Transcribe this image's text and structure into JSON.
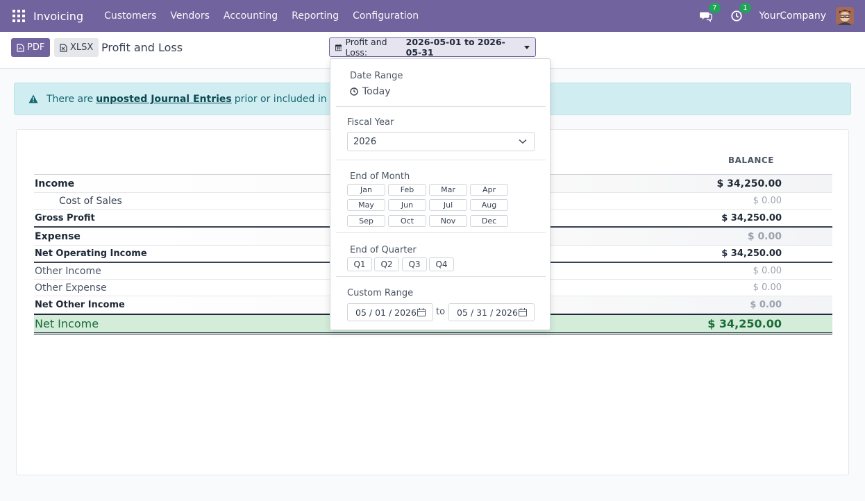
{
  "navbar": {
    "app_name": "Invoicing",
    "menu": [
      "Customers",
      "Vendors",
      "Accounting",
      "Reporting",
      "Configuration"
    ],
    "messages_count": "7",
    "activities_count": "1",
    "company": "YourCompany"
  },
  "control": {
    "pdf_label": "PDF",
    "xlsx_label": "XLSX",
    "title": "Profit and Loss",
    "filter_prefix": "Profit and Loss:",
    "filter_range": "2026-05-01 to 2026-05-31"
  },
  "alert": {
    "text_before": "There are",
    "link": "unposted Journal Entries",
    "text_after": "prior or included in this pe"
  },
  "report": {
    "column_header": "BALANCE",
    "rows": [
      {
        "label": "Income",
        "value": "$ 34,250.00"
      },
      {
        "label": "Cost of Sales",
        "value": "$ 0.00"
      },
      {
        "label": "Gross Profit",
        "value": "$ 34,250.00"
      },
      {
        "label": "Expense",
        "value": "$ 0.00"
      },
      {
        "label": "Net Operating Income",
        "value": "$ 34,250.00"
      },
      {
        "label": "Other Income",
        "value": "$ 0.00"
      },
      {
        "label": "Other Expense",
        "value": "$ 0.00"
      },
      {
        "label": "Net Other Income",
        "value": "$ 0.00"
      },
      {
        "label": "Net Income",
        "value": "$ 34,250.00"
      }
    ]
  },
  "dropdown": {
    "date_range_label": "Date Range",
    "today_label": "Today",
    "fiscal_year_label": "Fiscal Year",
    "fiscal_year_value": "2026",
    "end_of_month_label": "End of Month",
    "months": [
      "Jan",
      "Feb",
      "Mar",
      "Apr",
      "May",
      "Jun",
      "Jul",
      "Aug",
      "Sep",
      "Oct",
      "Nov",
      "Dec"
    ],
    "end_of_quarter_label": "End of Quarter",
    "quarters": [
      "Q1",
      "Q2",
      "Q3",
      "Q4"
    ],
    "custom_range_label": "Custom Range",
    "date_from": "05 / 01 / 2026",
    "to_label": "to",
    "date_to": "05 / 31 / 2026"
  },
  "colors": {
    "brand": "#71639e",
    "alert_bg": "#d0eef2",
    "net_income_bg": "#d4edda",
    "badge": "#22a35a"
  },
  "icons": [
    "apps-grid-icon",
    "chat-icon",
    "clock-icon",
    "avatar",
    "file-pdf-icon",
    "file-excel-icon",
    "calendar-icon",
    "warning-icon",
    "chevron-down-icon"
  ]
}
